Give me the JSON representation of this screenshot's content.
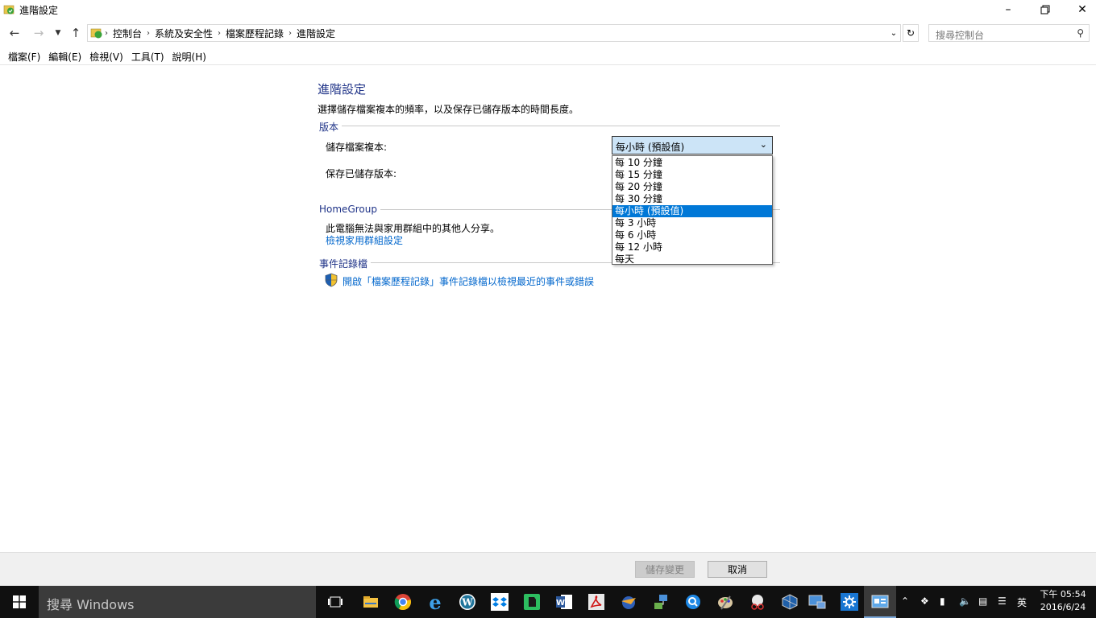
{
  "window": {
    "title": "進階設定"
  },
  "address": {
    "crumbs": [
      "控制台",
      "系統及安全性",
      "檔案歷程記錄",
      "進階設定"
    ]
  },
  "search": {
    "placeholder": "搜尋控制台"
  },
  "menu": [
    "檔案(F)",
    "編輯(E)",
    "檢視(V)",
    "工具(T)",
    "說明(H)"
  ],
  "main": {
    "heading": "進階設定",
    "description": "選擇儲存檔案複本的頻率，以及保存已儲存版本的時間長度。",
    "versions": {
      "section": "版本",
      "save_copies_label": "儲存檔案複本:",
      "keep_versions_label": "保存已儲存版本:",
      "selected": "每小時 (預設值)",
      "options": [
        "每 10 分鐘",
        "每 15 分鐘",
        "每 20 分鐘",
        "每 30 分鐘",
        "每小時 (預設值)",
        "每 3 小時",
        "每 6 小時",
        "每 12 小時",
        "每天"
      ],
      "selected_index": 4
    },
    "homegroup": {
      "section": "HomeGroup",
      "text": "此電腦無法與家用群組中的其他人分享。",
      "link": "檢視家用群組設定"
    },
    "eventlog": {
      "section": "事件記錄檔",
      "link": "開啟「檔案歷程記錄」事件記錄檔以檢視最近的事件或錯誤"
    }
  },
  "footer": {
    "save": "儲存變更",
    "cancel": "取消"
  },
  "taskbar": {
    "search_placeholder": "搜尋 Windows",
    "ime": "英",
    "time": "下午 05:54",
    "date": "2016/6/24"
  },
  "colors": {
    "accent": "#0078d7",
    "link": "#0066cc",
    "heading": "#1e3287"
  }
}
